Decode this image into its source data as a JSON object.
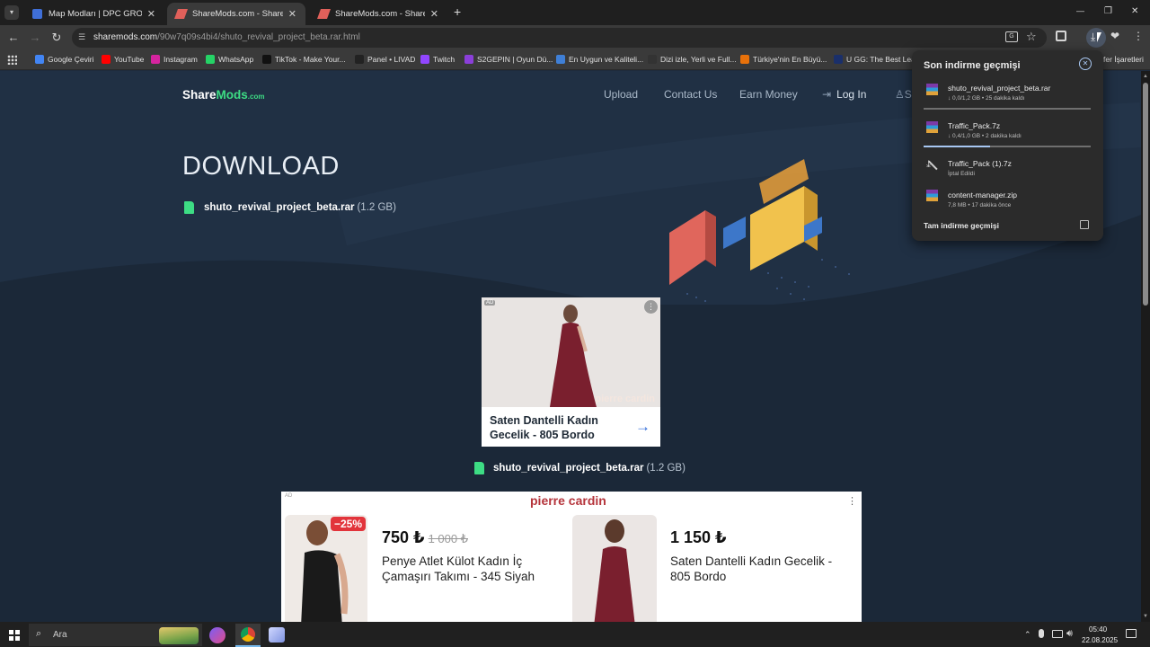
{
  "tabs": [
    {
      "title": "Map Modları | DPC GROUP - A...",
      "favicon_color": "#3f6fd8"
    },
    {
      "title": "ShareMods.com - Share your g...",
      "favicon_color": "#e0605a"
    },
    {
      "title": "ShareMods.com - Share your g...",
      "favicon_color": "#e0605a"
    }
  ],
  "new_tab_label": "+",
  "window_controls": {
    "minimize": "—",
    "maximize": "❐",
    "close": "✕"
  },
  "url": {
    "host": "sharemods.com",
    "path": "/90w7q09s4bi4/shuto_revival_project_beta.rar.html"
  },
  "bookmarks": [
    {
      "label": "Google Çeviri",
      "color": "#4285f4"
    },
    {
      "label": "YouTube",
      "color": "#ff0000"
    },
    {
      "label": "Instagram",
      "color": "#d6249f"
    },
    {
      "label": "WhatsApp",
      "color": "#25d366"
    },
    {
      "label": "TikTok - Make Your...",
      "color": "#111111"
    },
    {
      "label": "Panel • LIVAD",
      "color": "#222222"
    },
    {
      "label": "Twitch",
      "color": "#9146ff"
    },
    {
      "label": "S2GEPIN | Oyun Dü...",
      "color": "#8b3fd9"
    },
    {
      "label": "En Uygun ve Kaliteli...",
      "color": "#3f7fd6"
    },
    {
      "label": "Dizi izle, Yerli ve Full...",
      "color": "#333333"
    },
    {
      "label": "Türkiye'nin En Büyü...",
      "color": "#e8710a"
    },
    {
      "label": "U GG: The Best Lea...",
      "color": "#1a2f6a"
    }
  ],
  "bookmarks_overflow": "fer İşaretleri",
  "site": {
    "logo_share": "Share",
    "logo_mods": "Mods",
    "logo_com": ".com",
    "nav": [
      "Upload",
      "Contact Us",
      "Earn Money"
    ],
    "login": "Log In",
    "signup_partial": "S",
    "heading": "DOWNLOAD",
    "file_name": "shuto_revival_project_beta.rar",
    "file_size": "(1.2 GB)"
  },
  "ad_small": {
    "badge": "AD",
    "brand": "pierre cardin",
    "title": "Saten Dantelli Kadın Gecelik - 805 Bordo",
    "arrow": "→"
  },
  "ad_large": {
    "badge": "AD",
    "brand": "pierre cardin",
    "item1": {
      "discount": "−25%",
      "price": "750 ₺",
      "old_price": "1 000 ₺",
      "title": "Penye Atlet Külot Kadın İç Çamaşırı Takımı - 345 Siyah"
    },
    "item2": {
      "price": "1 150 ₺",
      "title": "Saten Dantelli Kadın Gecelik - 805 Bordo"
    }
  },
  "download_panel": {
    "title": "Son indirme geçmişi",
    "items": [
      {
        "name": "shuto_revival_project_beta.rar",
        "meta": "↓ 0,0/1,2 GB • 25 dakika kaldı",
        "progress": 0.0
      },
      {
        "name": "Traffic_Pack.7z",
        "meta": "↓ 0,4/1,0 GB • 2 dakika kaldı",
        "progress": 0.4
      },
      {
        "name": "Traffic_Pack (1).7z",
        "meta": "İptal Edildi"
      },
      {
        "name": "content-manager.zip",
        "meta": "7,8 MB • 17 dakika önce"
      }
    ],
    "footer": "Tam indirme geçmişi"
  },
  "taskbar": {
    "search": "Ara",
    "time": "05:40",
    "date": "22.08.2025"
  },
  "colors": {
    "accent_green": "#3ddc84",
    "brand_red": "#b5343b",
    "page_bg": "#1b2838"
  }
}
